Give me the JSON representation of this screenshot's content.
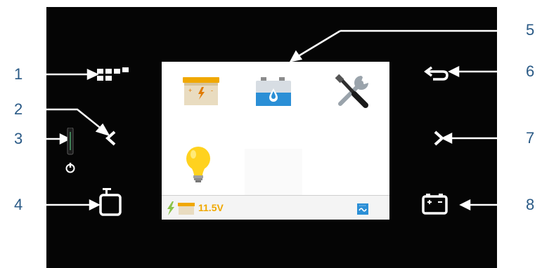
{
  "callouts": {
    "c1": "1",
    "c2": "2",
    "c3": "3",
    "c4": "4",
    "c5": "5",
    "c6": "6",
    "c7": "7",
    "c8": "8"
  },
  "screen": {
    "menu_icons": [
      "battery-charger-icon",
      "battery-water-level-icon",
      "tools-settings-icon",
      "light-bulb-icon"
    ],
    "status": {
      "voltage": "11.5V",
      "icons": [
        "charging-bolt-icon",
        "battery-icon",
        "ac-power-icon"
      ]
    }
  },
  "buttons": [
    "menu-grid-icon",
    "left-chevron-icon",
    "power-icon",
    "tv-icon",
    "return-arrow-icon",
    "right-chevron-icon",
    "battery-icon"
  ],
  "colors": {
    "callout_text": "#2a5a86",
    "device": "#050505",
    "accent_orange": "#f0a800",
    "accent_blue": "#2b8fd6"
  }
}
